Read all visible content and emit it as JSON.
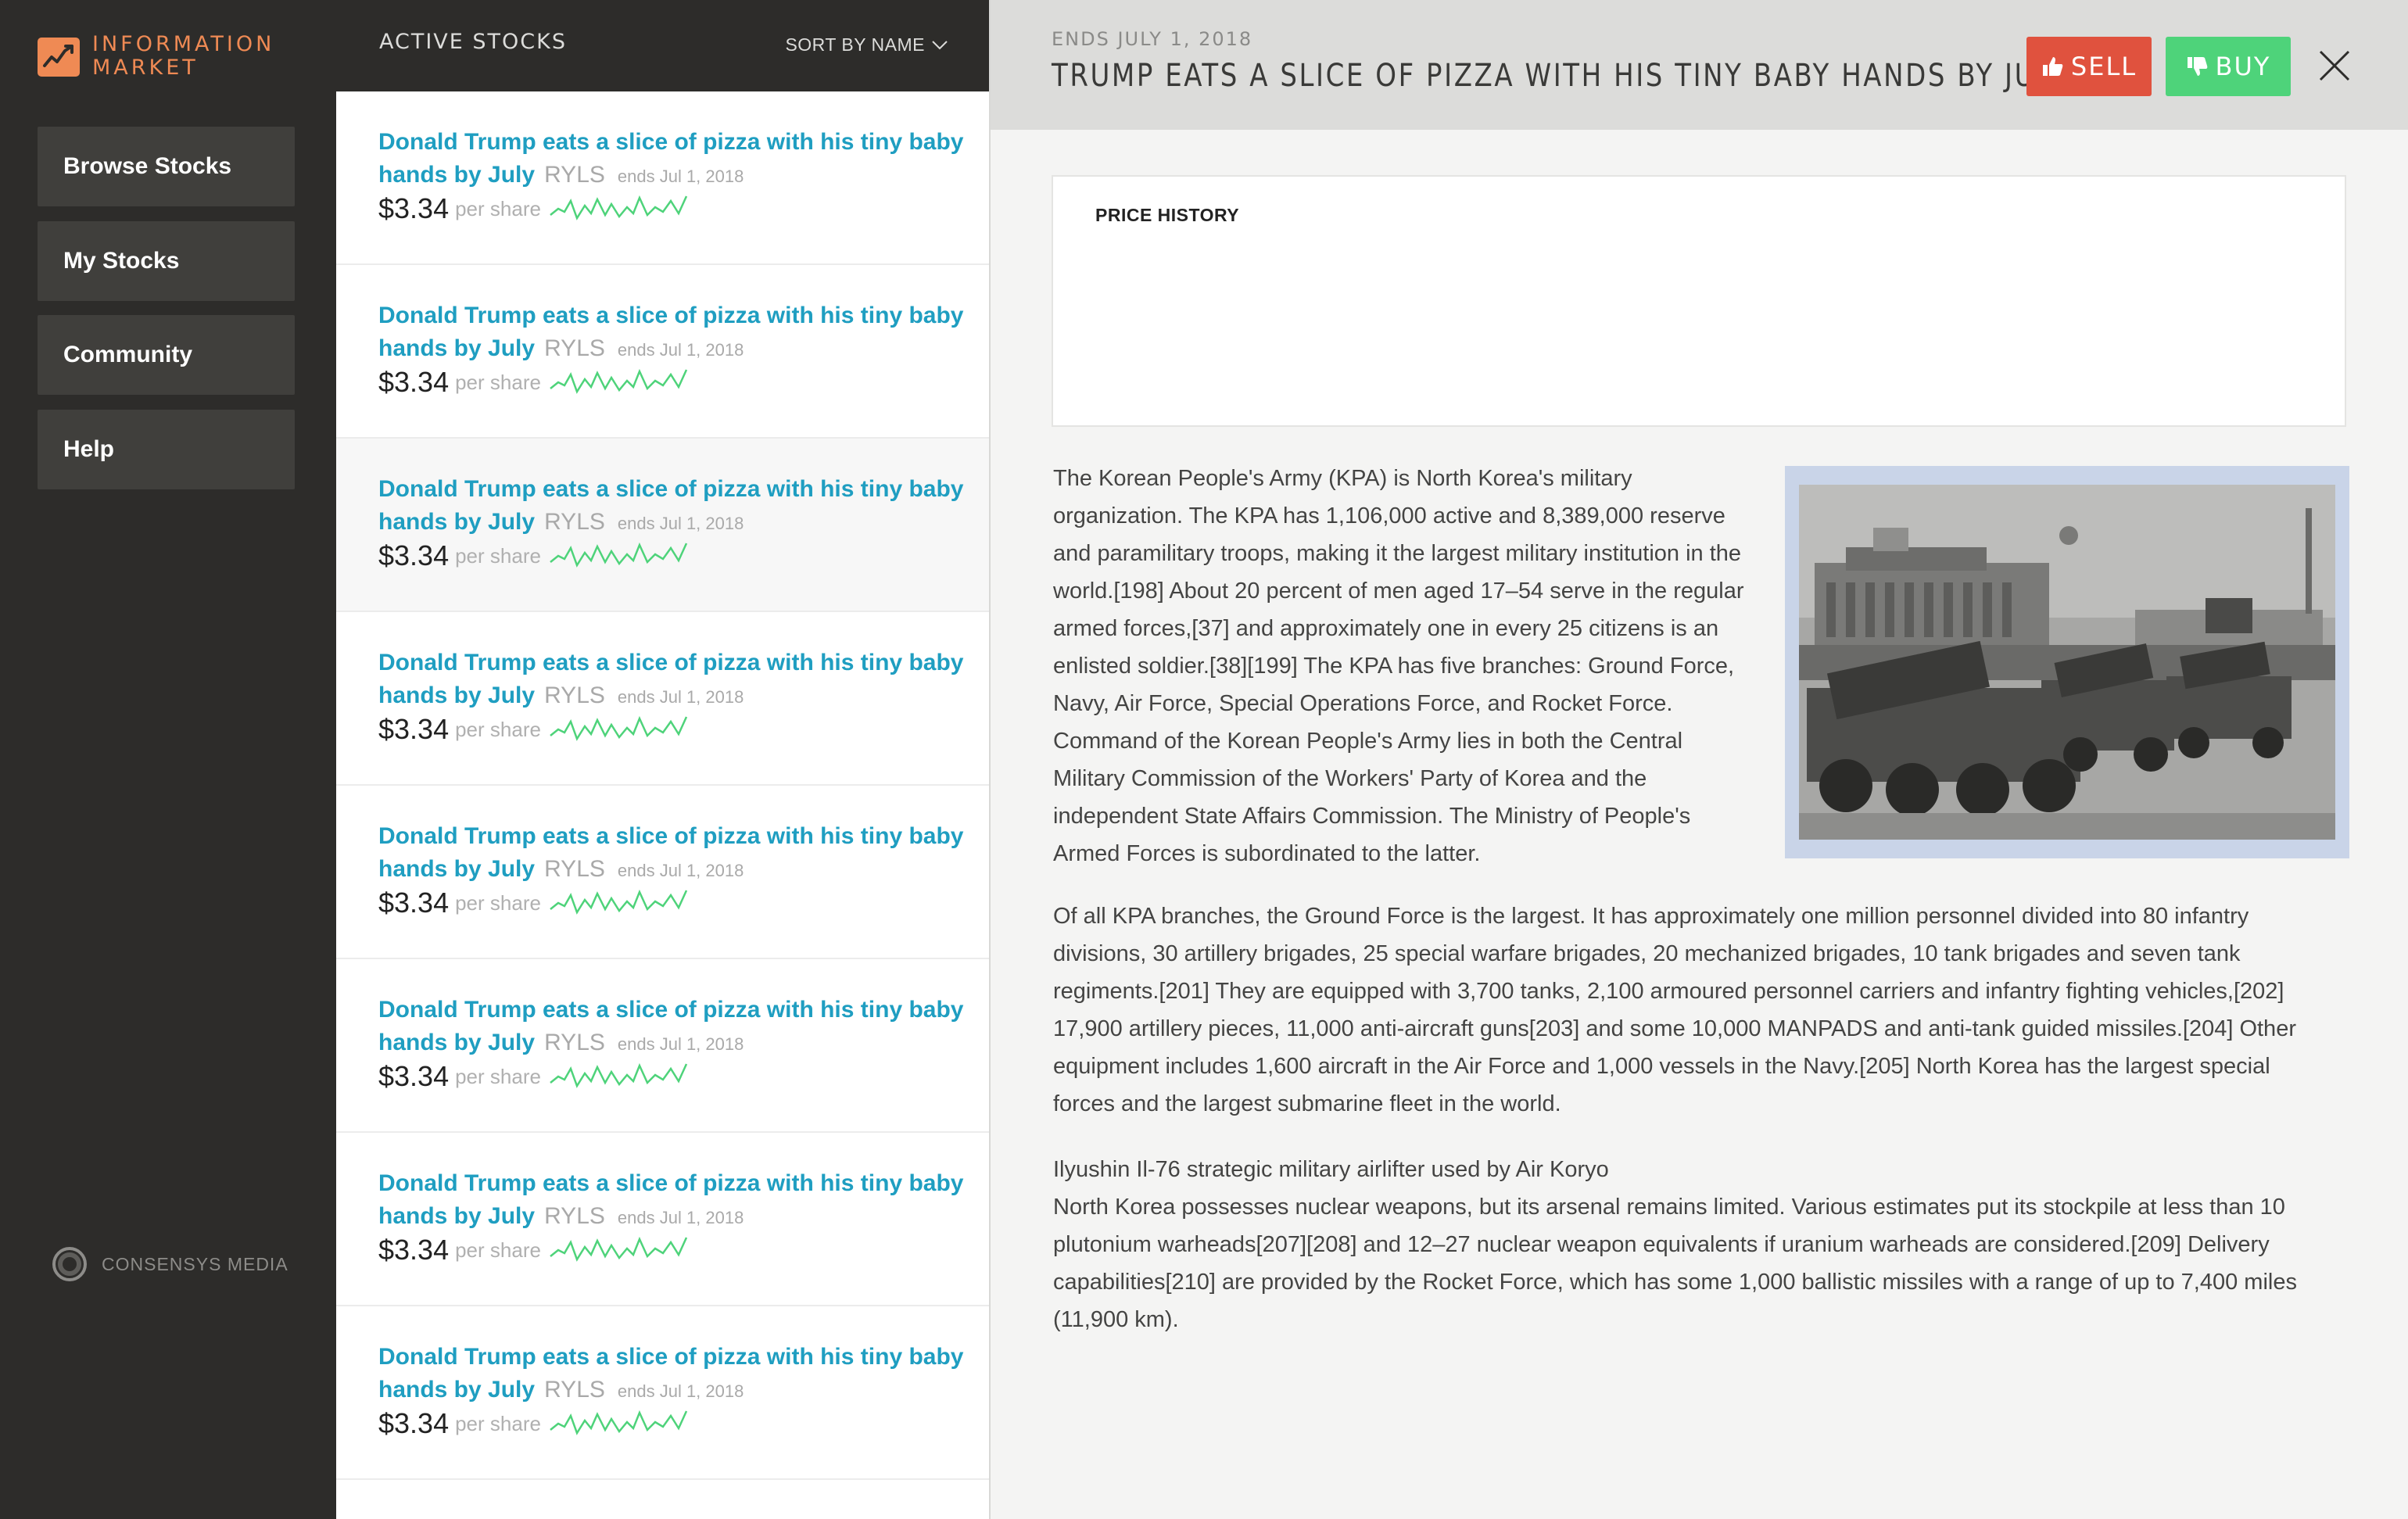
{
  "brand": {
    "name_line1": "INFORMATION",
    "name_line2": "MARKET",
    "accent": "#ef8a54",
    "icon": "trending-chart-icon"
  },
  "nav": {
    "items": [
      {
        "label": "Browse Stocks"
      },
      {
        "label": "My Stocks"
      },
      {
        "label": "Community"
      },
      {
        "label": "Help"
      }
    ],
    "footer": "CONSENSYS MEDIA"
  },
  "list": {
    "title": "ACTIVE STOCKS",
    "sort_label": "SORT BY NAME",
    "link_color": "#1f9ec1",
    "items": [
      {
        "title": "Donald Trump eats a slice of pizza with his tiny baby hands by July",
        "ticker": "RYLS",
        "ends": "ends Jul 1, 2018",
        "price": "$3.34",
        "per": "per share"
      },
      {
        "title": "Donald Trump eats a slice of pizza with his tiny baby hands by July",
        "ticker": "RYLS",
        "ends": "ends Jul 1, 2018",
        "price": "$3.34",
        "per": "per share"
      },
      {
        "title": "Donald Trump eats a slice of pizza with his tiny baby hands by July",
        "ticker": "RYLS",
        "ends": "ends Jul 1, 2018",
        "price": "$3.34",
        "per": "per share"
      },
      {
        "title": "Donald Trump eats a slice of pizza with his tiny baby hands by July",
        "ticker": "RYLS",
        "ends": "ends Jul 1, 2018",
        "price": "$3.34",
        "per": "per share"
      },
      {
        "title": "Donald Trump eats a slice of pizza with his tiny baby hands by July",
        "ticker": "RYLS",
        "ends": "ends Jul 1, 2018",
        "price": "$3.34",
        "per": "per share"
      },
      {
        "title": "Donald Trump eats a slice of pizza with his tiny baby hands by July",
        "ticker": "RYLS",
        "ends": "ends Jul 1, 2018",
        "price": "$3.34",
        "per": "per share"
      },
      {
        "title": "Donald Trump eats a slice of pizza with his tiny baby hands by July",
        "ticker": "RYLS",
        "ends": "ends Jul 1, 2018",
        "price": "$3.34",
        "per": "per share"
      },
      {
        "title": "Donald Trump eats a slice of pizza with his tiny baby hands by July",
        "ticker": "RYLS",
        "ends": "ends Jul 1, 2018",
        "price": "$3.34",
        "per": "per share"
      }
    ]
  },
  "detail": {
    "ends": "ENDS JULY 1, 2018",
    "title": "TRUMP EATS A SLICE OF PIZZA WITH HIS TINY BABY HANDS BY JULY",
    "sell_label": "SELL",
    "buy_label": "BUY",
    "sell_color": "#e0523e",
    "buy_color": "#4ed37a",
    "history_title": "PRICE HISTORY",
    "paragraph1": "The Korean People's Army (KPA) is North Korea's military organization. The KPA has 1,106,000 active and 8,389,000 reserve and paramilitary troops, making it the largest military institution in the world.[198] About 20 percent of men aged 17–54 serve in the regular armed forces,[37] and approximately one in every 25 citizens is an enlisted soldier.[38][199] The KPA has five branches: Ground Force, Navy, Air Force, Special Operations Force, and Rocket Force. Command of the Korean People's Army lies in both the Central Military Commission of the Workers' Party of Korea and the independent State Affairs Commission. The Ministry of People's Armed Forces is subordinated to the latter.",
    "paragraph2": "Of all KPA branches, the Ground Force is the largest. It has approximately one million personnel divided into 80 infantry divisions, 30 artillery brigades, 25 special warfare brigades, 20 mechanized brigades, 10 tank brigades and seven tank regiments.[201] They are equipped with 3,700 tanks, 2,100 armoured personnel carriers and infantry fighting vehicles,[202] 17,900 artillery pieces, 11,000 anti-aircraft guns[203] and some 10,000 MANPADS and anti-tank guided missiles.[204] Other equipment includes 1,600 aircraft in the Air Force and 1,000 vessels in the Navy.[205] North Korea has the largest special forces and the largest submarine fleet in the world.",
    "paragraph3_caption": "Ilyushin Il-76 strategic military airlifter used by Air Koryo",
    "paragraph3": "North Korea possesses nuclear weapons, but its arsenal remains limited. Various estimates put its stockpile at less than 10 plutonium warheads[207][208] and 12–27 nuclear weapon equivalents if uranium warheads are considered.[209] Delivery capabilities[210] are provided by the Rocket Force, which has some 1,000 ballistic missiles with a range of up to 7,400 miles (11,900 km)."
  }
}
